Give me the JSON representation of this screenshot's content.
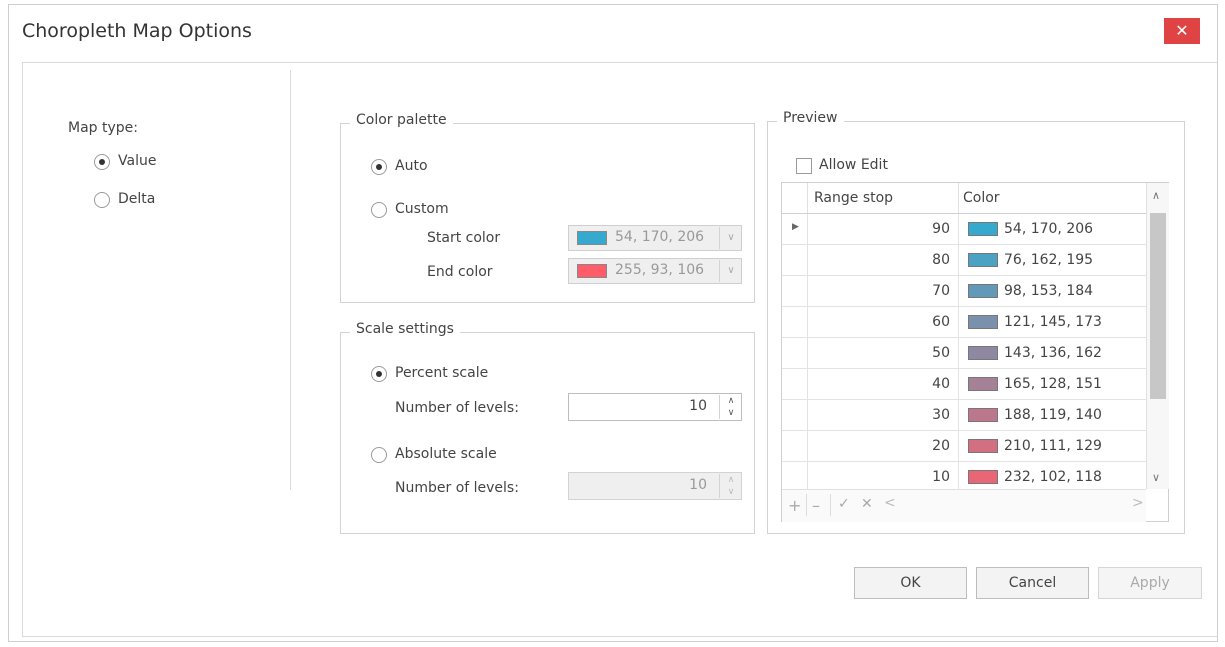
{
  "dialog": {
    "title": "Choropleth Map Options",
    "close_glyph": "✕"
  },
  "map_type": {
    "label": "Map type:",
    "options": [
      {
        "label": "Value",
        "checked": true
      },
      {
        "label": "Delta",
        "checked": false
      }
    ]
  },
  "color_palette": {
    "title": "Color palette",
    "auto_label": "Auto",
    "custom_label": "Custom",
    "start_label": "Start color",
    "start_value": "54, 170, 206",
    "start_hex": "#36aace",
    "end_label": "End color",
    "end_value": "255, 93, 106",
    "end_hex": "#ff5d6a"
  },
  "scale": {
    "title": "Scale settings",
    "percent_label": "Percent scale",
    "percent_levels_label": "Number of levels:",
    "percent_levels": "10",
    "absolute_label": "Absolute scale",
    "absolute_levels_label": "Number of levels:",
    "absolute_levels": "10"
  },
  "preview": {
    "title": "Preview",
    "allow_edit": "Allow Edit",
    "col_stop": "Range stop",
    "col_color": "Color",
    "rows": [
      {
        "stop": "90",
        "color": "54, 170, 206",
        "hex": "#36aace"
      },
      {
        "stop": "80",
        "color": "76, 162, 195",
        "hex": "#4ca2c3"
      },
      {
        "stop": "70",
        "color": "98, 153, 184",
        "hex": "#6299b8"
      },
      {
        "stop": "60",
        "color": "121, 145, 173",
        "hex": "#7991ad"
      },
      {
        "stop": "50",
        "color": "143, 136, 162",
        "hex": "#8f88a2"
      },
      {
        "stop": "40",
        "color": "165, 128, 151",
        "hex": "#a58097"
      },
      {
        "stop": "30",
        "color": "188, 119, 140",
        "hex": "#bc778c"
      },
      {
        "stop": "20",
        "color": "210, 111, 129",
        "hex": "#d26f81"
      },
      {
        "stop": "10",
        "color": "232, 102, 118",
        "hex": "#e86676"
      }
    ]
  },
  "buttons": {
    "ok": "OK",
    "cancel": "Cancel",
    "apply": "Apply"
  }
}
